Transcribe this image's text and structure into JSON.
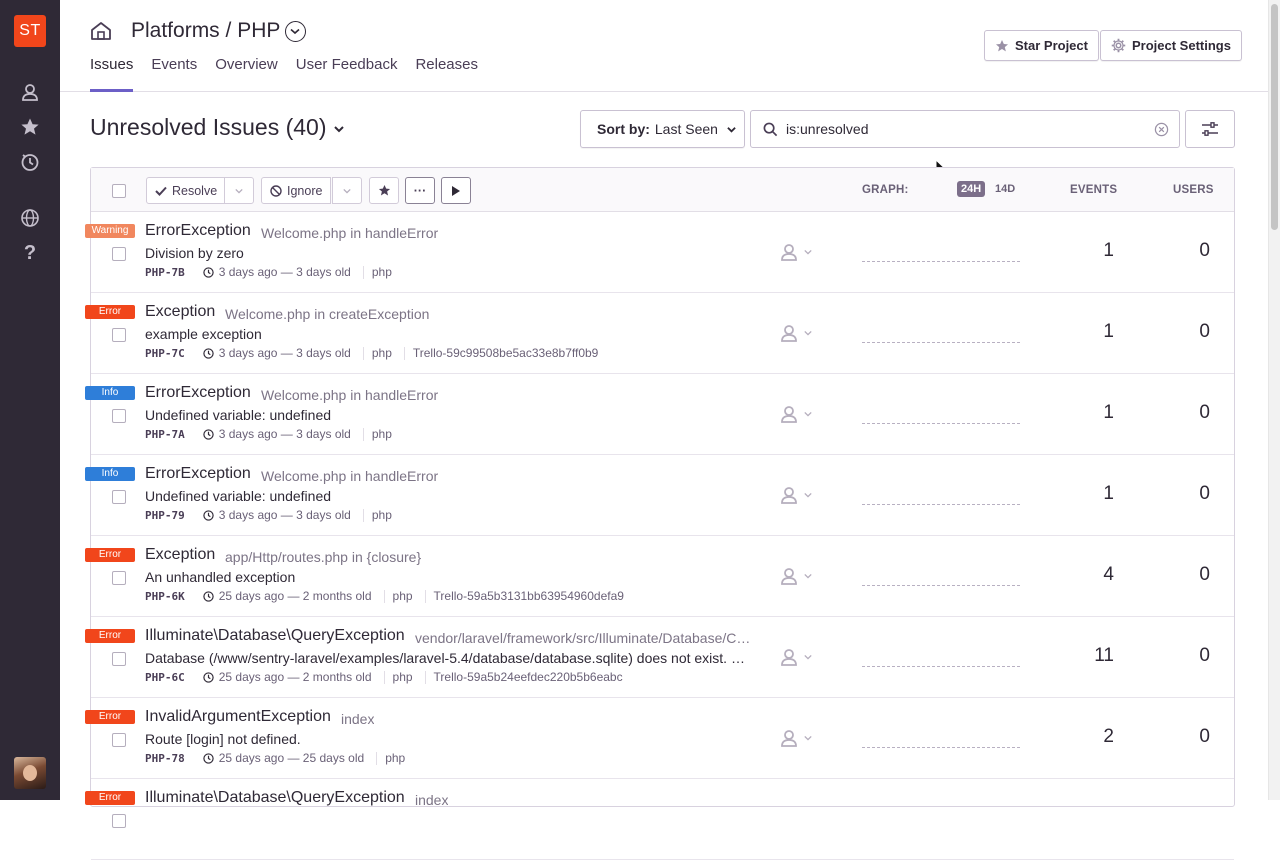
{
  "colors": {
    "sidebar": "#2f2936",
    "org_badge": "#f1461b",
    "accent": "#6c5fc7",
    "level_warning": "#f1875e",
    "level_error": "#f1461b",
    "level_info": "#2e7ed9"
  },
  "sidebar": {
    "org_initials": "ST",
    "icons": [
      "user-icon",
      "star-icon",
      "activity-icon",
      "globe-icon",
      "help-icon"
    ]
  },
  "header": {
    "project_title": "Platforms / PHP",
    "tabs": [
      {
        "label": "Issues",
        "active": true
      },
      {
        "label": "Events",
        "active": false
      },
      {
        "label": "Overview",
        "active": false
      },
      {
        "label": "User Feedback",
        "active": false
      },
      {
        "label": "Releases",
        "active": false
      }
    ],
    "star_project_label": "Star Project",
    "project_settings_label": "Project Settings"
  },
  "toolbar": {
    "title": "Unresolved Issues (40)",
    "sort_prefix": "Sort by:",
    "sort_value": "Last Seen",
    "search_query": "is:unresolved"
  },
  "table": {
    "resolve_label": "Resolve",
    "ignore_label": "Ignore",
    "more_label": "···",
    "graph_label": "GRAPH:",
    "range_24h": "24H",
    "range_14d": "14D",
    "events_label": "EVENTS",
    "users_label": "USERS"
  },
  "issues": [
    {
      "level": "Warning",
      "level_color": "#f1875e",
      "title": "ErrorException",
      "culprit": "Welcome.php in handleError",
      "message": "Division by zero",
      "short_id": "PHP-7B",
      "time": "3 days ago — 3 days old",
      "platform": "php",
      "extra": "",
      "events": "1",
      "users": "0"
    },
    {
      "level": "Error",
      "level_color": "#f1461b",
      "title": "Exception",
      "culprit": "Welcome.php in createException",
      "message": "example exception",
      "short_id": "PHP-7C",
      "time": "3 days ago — 3 days old",
      "platform": "php",
      "extra": "Trello-59c99508be5ac33e8b7ff0b9",
      "events": "1",
      "users": "0"
    },
    {
      "level": "Info",
      "level_color": "#2e7ed9",
      "title": "ErrorException",
      "culprit": "Welcome.php in handleError",
      "message": "Undefined variable: undefined",
      "short_id": "PHP-7A",
      "time": "3 days ago — 3 days old",
      "platform": "php",
      "extra": "",
      "events": "1",
      "users": "0"
    },
    {
      "level": "Info",
      "level_color": "#2e7ed9",
      "title": "ErrorException",
      "culprit": "Welcome.php in handleError",
      "message": "Undefined variable: undefined",
      "short_id": "PHP-79",
      "time": "3 days ago — 3 days old",
      "platform": "php",
      "extra": "",
      "events": "1",
      "users": "0"
    },
    {
      "level": "Error",
      "level_color": "#f1461b",
      "title": "Exception",
      "culprit": "app/Http/routes.php in {closure}",
      "message": "An unhandled exception",
      "short_id": "PHP-6K",
      "time": "25 days ago — 2 months old",
      "platform": "php",
      "extra": "Trello-59a5b3131bb63954960defa9",
      "events": "4",
      "users": "0"
    },
    {
      "level": "Error",
      "level_color": "#f1461b",
      "title": "Illuminate\\Database\\QueryException",
      "culprit": "vendor/laravel/framework/src/Illuminate/Database/Connection.php",
      "message": "Database (/www/sentry-laravel/examples/laravel-5.4/database/database.sqlite) does not exist. (SQL: select * from users)",
      "short_id": "PHP-6C",
      "time": "25 days ago — 2 months old",
      "platform": "php",
      "extra": "Trello-59a5b24eefdec220b5b6eabc",
      "events": "11",
      "users": "0"
    },
    {
      "level": "Error",
      "level_color": "#f1461b",
      "title": "InvalidArgumentException",
      "culprit": "index",
      "message": "Route [login] not defined.",
      "short_id": "PHP-78",
      "time": "25 days ago — 25 days old",
      "platform": "php",
      "extra": "",
      "events": "2",
      "users": "0"
    },
    {
      "level": "Error",
      "level_color": "#f1461b",
      "title": "Illuminate\\Database\\QueryException",
      "culprit": "index",
      "message": "",
      "short_id": "",
      "time": "",
      "platform": "",
      "extra": "",
      "events": "",
      "users": ""
    }
  ]
}
